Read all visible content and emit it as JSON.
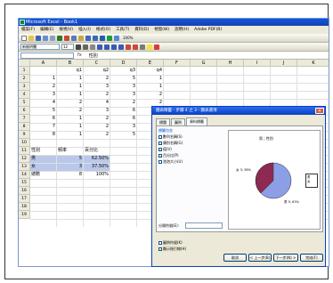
{
  "app": {
    "title": "Microsoft Excel - Book1",
    "menu": [
      "檔案(F)",
      "編輯(E)",
      "檢視(V)",
      "插入(I)",
      "格式(O)",
      "工具(T)",
      "資料(D)",
      "視窗(W)",
      "說明(H)",
      "Adobe PDF(B)"
    ],
    "font_name": "新細明體",
    "font_size": "12",
    "zoom": "100%",
    "formula_value": "性別"
  },
  "colors": {
    "accent": "#0a3fc0",
    "selection": "#b9c8ea",
    "pie_main": "#8b9ee6",
    "pie_slice": "#8e2a52"
  },
  "sheet": {
    "columns": [
      "A",
      "B",
      "C",
      "D",
      "E",
      "F",
      "G",
      "H",
      "I",
      "J",
      "K"
    ],
    "rows": [
      "1",
      "2",
      "3",
      "4",
      "5",
      "6",
      "7",
      "8",
      "9",
      "10",
      "11",
      "12",
      "13",
      "14",
      "15",
      "16",
      "17",
      "18",
      "19"
    ],
    "header_row": [
      "q1",
      "q2",
      "q3",
      "q4"
    ],
    "data_rows": [
      [
        "1",
        "1",
        "2",
        "5",
        "1"
      ],
      [
        "2",
        "1",
        "3",
        "3",
        "1"
      ],
      [
        "3",
        "1",
        "2",
        "3",
        "2"
      ],
      [
        "4",
        "2",
        "4",
        "2",
        "2"
      ],
      [
        "5",
        "2",
        "3",
        "6",
        "1"
      ],
      [
        "6",
        "1",
        "2",
        "6",
        "1"
      ],
      [
        "7",
        "1",
        "2",
        "3",
        "2"
      ],
      [
        "8",
        "1",
        "2",
        "5",
        "2"
      ]
    ],
    "summary_header": [
      "性別",
      "頻率",
      "百分比"
    ],
    "summary_rows": [
      [
        "男",
        "5",
        "62.50%"
      ],
      [
        "女",
        "3",
        "37.50%"
      ],
      [
        "總數",
        "8",
        "100%"
      ]
    ]
  },
  "dialog": {
    "title": "圖表精靈 - 步驟 4 之 3 - 圖表選項",
    "close": "✕",
    "tabs": [
      "標題",
      "圖例",
      "資料標籤"
    ],
    "group_label": "標籤包含",
    "options": [
      {
        "label": "數列名稱(S)",
        "checked": false
      },
      {
        "label": "類別名稱(G)",
        "checked": true
      },
      {
        "label": "值(V)",
        "checked": true
      },
      {
        "label": "百分比(P)",
        "checked": true
      },
      {
        "label": "泡泡大小(U)",
        "checked": false
      }
    ],
    "separator_label": "分隔符號(E):",
    "extra_options": [
      {
        "label": "圖例符號(K)",
        "checked": false
      },
      {
        "label": "顯示指引線(H)",
        "checked": true
      }
    ],
    "preview": {
      "title": "男 ; 性別",
      "label_a": "女 3; 38%",
      "label_b": "男 5; 63%",
      "legend": [
        "男",
        "女"
      ]
    },
    "buttons": [
      "取消",
      "< 上一步(B)",
      "下一步(N) >",
      "完成(F)"
    ]
  }
}
